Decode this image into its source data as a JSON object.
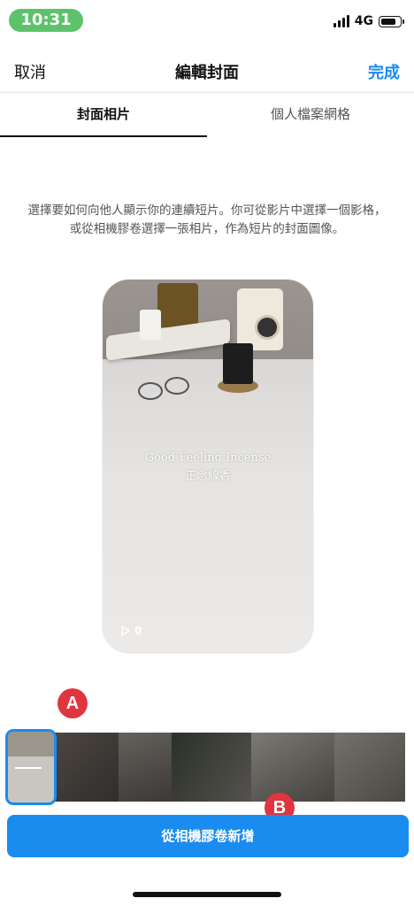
{
  "status_bar": {
    "time": "10:31",
    "network": "4G"
  },
  "nav": {
    "cancel_label": "取消",
    "title": "編輯封面",
    "done_label": "完成"
  },
  "tabs": [
    {
      "label": "封面相片",
      "active": true
    },
    {
      "label": "個人檔案網格",
      "active": false
    }
  ],
  "instructions": "選擇要如何向他人顯示你的連續短片。你可從影片中選擇一個影格，或從相機膠卷選擇一張相片，作為短片的封面圖像。",
  "preview": {
    "overlay_text_en": "Good Feeling Incense",
    "overlay_text_zh": "正念線香",
    "play_count": "0"
  },
  "annotations": {
    "badge_a": "A",
    "badge_b": "B"
  },
  "add_from_camera_roll_label": "從相機膠卷新增",
  "colors": {
    "accent": "#1a8cf0",
    "badge": "#e0353f",
    "time_pill": "#5ec26a"
  }
}
